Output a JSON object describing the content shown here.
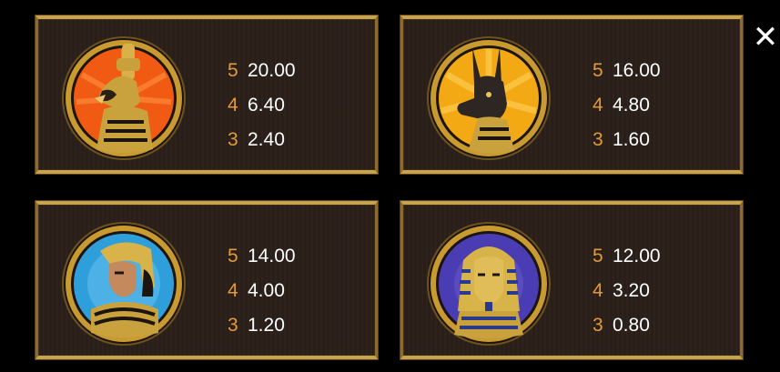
{
  "close": {
    "glyph": "✕"
  },
  "symbols": [
    {
      "icon": "horus-falcon-icon",
      "bg_color": "#f05a12",
      "payouts": [
        {
          "count": "5",
          "value": "20.00"
        },
        {
          "count": "4",
          "value": "6.40"
        },
        {
          "count": "3",
          "value": "2.40"
        }
      ]
    },
    {
      "icon": "anubis-jackal-icon",
      "bg_color": "#f3a914",
      "payouts": [
        {
          "count": "5",
          "value": "16.00"
        },
        {
          "count": "4",
          "value": "4.80"
        },
        {
          "count": "3",
          "value": "1.60"
        }
      ]
    },
    {
      "icon": "cleopatra-icon",
      "bg_color": "#2f9fdc",
      "payouts": [
        {
          "count": "5",
          "value": "14.00"
        },
        {
          "count": "4",
          "value": "4.00"
        },
        {
          "count": "3",
          "value": "1.20"
        }
      ]
    },
    {
      "icon": "pharaoh-mask-icon",
      "bg_color": "#4a3cb3",
      "payouts": [
        {
          "count": "5",
          "value": "12.00"
        },
        {
          "count": "4",
          "value": "3.20"
        },
        {
          "count": "3",
          "value": "0.80"
        }
      ]
    }
  ]
}
